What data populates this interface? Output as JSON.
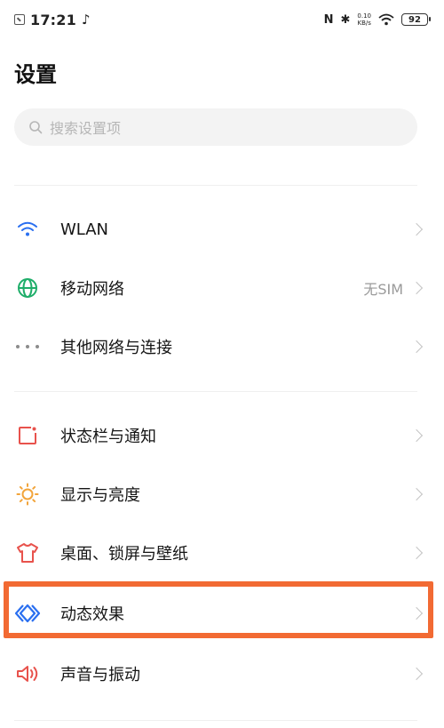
{
  "status_bar": {
    "time": "17:21",
    "net_speed_value": "0.10",
    "net_speed_unit": "KB/s",
    "battery": "92"
  },
  "header": {
    "title": "设置"
  },
  "search": {
    "placeholder": "搜索设置项"
  },
  "sections": [
    {
      "items": [
        {
          "label": "WLAN",
          "icon": "wifi-icon",
          "value": ""
        },
        {
          "label": "移动网络",
          "icon": "globe-icon",
          "value": "无SIM"
        },
        {
          "label": "其他网络与连接",
          "icon": "more-dots-icon",
          "value": ""
        }
      ]
    },
    {
      "items": [
        {
          "label": "状态栏与通知",
          "icon": "status-bar-icon",
          "value": ""
        },
        {
          "label": "显示与亮度",
          "icon": "sun-icon",
          "value": ""
        },
        {
          "label": "桌面、锁屏与壁纸",
          "icon": "shirt-icon",
          "value": ""
        },
        {
          "label": "动态效果",
          "icon": "diamond-icon",
          "value": "",
          "highlighted": true
        },
        {
          "label": "声音与振动",
          "icon": "speaker-icon",
          "value": ""
        }
      ]
    }
  ],
  "colors": {
    "accent_blue": "#2a6ff0",
    "green": "#1fae6a",
    "red": "#e8524c",
    "orange": "#f2a43a",
    "highlight": "#f26a33"
  }
}
